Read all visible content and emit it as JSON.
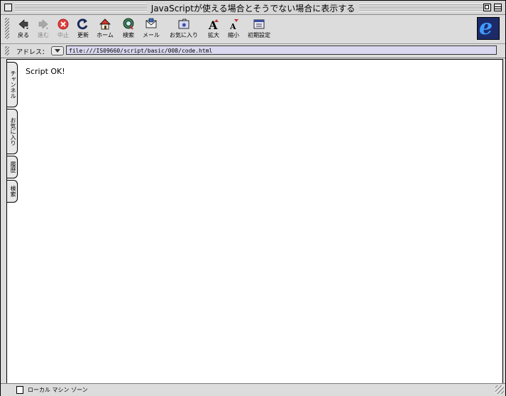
{
  "window": {
    "title": "JavaScriptが使える場合とそうでない場合に表示する"
  },
  "toolbar": {
    "buttons": [
      {
        "label": "戻る",
        "icon": "back-arrow-icon",
        "enabled": true
      },
      {
        "label": "進む",
        "icon": "forward-arrow-icon",
        "enabled": false
      },
      {
        "label": "中止",
        "icon": "stop-icon",
        "enabled": false
      },
      {
        "label": "更新",
        "icon": "refresh-icon",
        "enabled": true
      },
      {
        "label": "ホーム",
        "icon": "home-icon",
        "enabled": true
      },
      {
        "label": "検索",
        "icon": "search-icon",
        "enabled": true
      },
      {
        "label": "メール",
        "icon": "mail-icon",
        "enabled": true
      },
      {
        "label": "お気に入り",
        "icon": "favorites-icon",
        "enabled": true
      },
      {
        "label": "拡大",
        "icon": "text-larger-icon",
        "enabled": true
      },
      {
        "label": "縮小",
        "icon": "text-smaller-icon",
        "enabled": true
      },
      {
        "label": "初期設定",
        "icon": "preferences-icon",
        "enabled": true
      }
    ],
    "logo": "e"
  },
  "address": {
    "label": "アドレス：",
    "url": "file:///IS09660/script/basic/008/code.html"
  },
  "side_tabs": [
    "チャンネル",
    "お気に入り",
    "履歴",
    "検索"
  ],
  "content": {
    "text": "Script OK!"
  },
  "status": {
    "zone": "ローカル マシン ゾーン"
  },
  "colors": {
    "address_field": "#dad8f0",
    "chrome": "#dcdcdc",
    "stop_red": "#e0403a",
    "ie_blue": "#3f9bff"
  }
}
